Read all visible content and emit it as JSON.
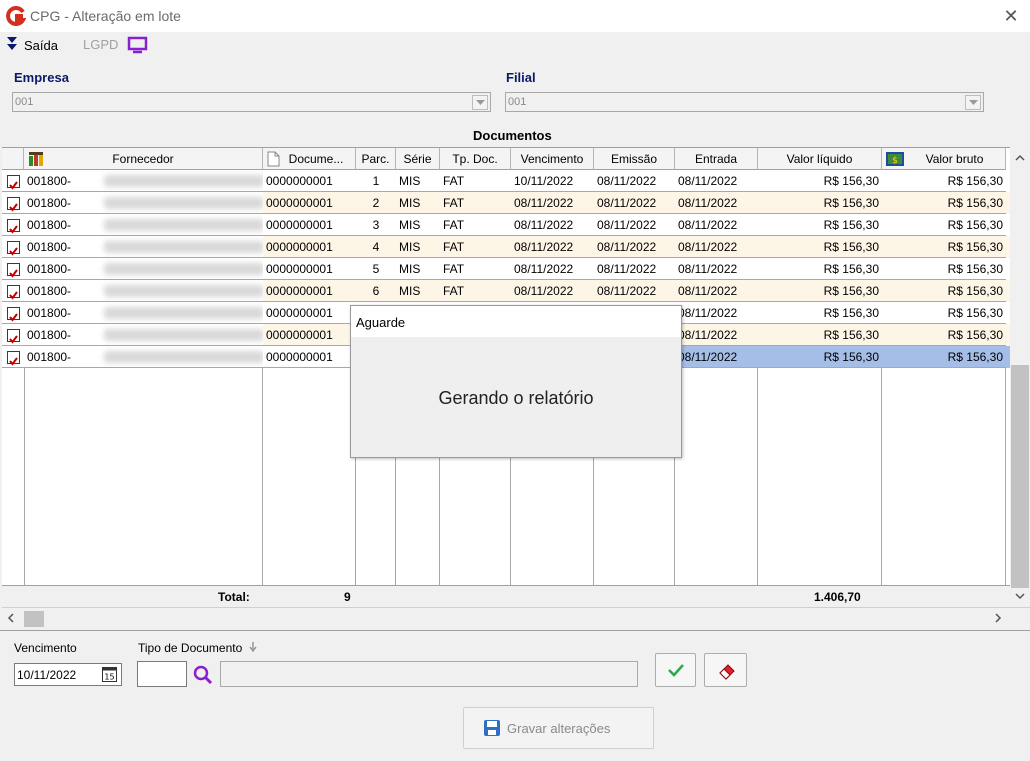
{
  "window": {
    "title": "CPG - Alteração em lote",
    "close_icon": "close-icon"
  },
  "toolbar": {
    "saida_label": "Saída",
    "lgpd_label": "LGPD"
  },
  "filters": {
    "empresa_label": "Empresa",
    "empresa_value": "001",
    "filial_label": "Filial",
    "filial_value": "001"
  },
  "grid": {
    "title": "Documentos",
    "headers": {
      "fornecedor": "Fornecedor",
      "documento": "Docume...",
      "parc": "Parc.",
      "serie": "Série",
      "tpdoc": "Tp. Doc.",
      "vencimento": "Vencimento",
      "emissao": "Emissão",
      "entrada": "Entrada",
      "valor_liquido": "Valor líquido",
      "valor_bruto": "Valor bruto"
    },
    "rows": [
      {
        "checked": true,
        "fornecedor": "001800-",
        "documento": "0000000001",
        "parc": "1",
        "serie": "MIS",
        "tpdoc": "FAT",
        "vencimento": "10/11/2022",
        "emissao": "08/11/2022",
        "entrada": "08/11/2022",
        "valor_liquido": "R$ 156,30",
        "valor_bruto": "R$ 156,30"
      },
      {
        "checked": true,
        "fornecedor": "001800-",
        "documento": "0000000001",
        "parc": "2",
        "serie": "MIS",
        "tpdoc": "FAT",
        "vencimento": "08/11/2022",
        "emissao": "08/11/2022",
        "entrada": "08/11/2022",
        "valor_liquido": "R$ 156,30",
        "valor_bruto": "R$ 156,30"
      },
      {
        "checked": true,
        "fornecedor": "001800-",
        "documento": "0000000001",
        "parc": "3",
        "serie": "MIS",
        "tpdoc": "FAT",
        "vencimento": "08/11/2022",
        "emissao": "08/11/2022",
        "entrada": "08/11/2022",
        "valor_liquido": "R$ 156,30",
        "valor_bruto": "R$ 156,30"
      },
      {
        "checked": true,
        "fornecedor": "001800-",
        "documento": "0000000001",
        "parc": "4",
        "serie": "MIS",
        "tpdoc": "FAT",
        "vencimento": "08/11/2022",
        "emissao": "08/11/2022",
        "entrada": "08/11/2022",
        "valor_liquido": "R$ 156,30",
        "valor_bruto": "R$ 156,30"
      },
      {
        "checked": true,
        "fornecedor": "001800-",
        "documento": "0000000001",
        "parc": "5",
        "serie": "MIS",
        "tpdoc": "FAT",
        "vencimento": "08/11/2022",
        "emissao": "08/11/2022",
        "entrada": "08/11/2022",
        "valor_liquido": "R$ 156,30",
        "valor_bruto": "R$ 156,30"
      },
      {
        "checked": true,
        "fornecedor": "001800-",
        "documento": "0000000001",
        "parc": "6",
        "serie": "MIS",
        "tpdoc": "FAT",
        "vencimento": "08/11/2022",
        "emissao": "08/11/2022",
        "entrada": "08/11/2022",
        "valor_liquido": "R$ 156,30",
        "valor_bruto": "R$ 156,30"
      },
      {
        "checked": true,
        "fornecedor": "001800-",
        "documento": "0000000001",
        "parc": "",
        "serie": "",
        "tpdoc": "",
        "vencimento": "",
        "emissao": "",
        "entrada": "08/11/2022",
        "valor_liquido": "R$ 156,30",
        "valor_bruto": "R$ 156,30"
      },
      {
        "checked": true,
        "fornecedor": "001800-",
        "documento": "0000000001",
        "parc": "",
        "serie": "",
        "tpdoc": "",
        "vencimento": "",
        "emissao": "",
        "entrada": "08/11/2022",
        "valor_liquido": "R$ 156,30",
        "valor_bruto": "R$ 156,30"
      },
      {
        "checked": true,
        "fornecedor": "001800-",
        "documento": "0000000001",
        "parc": "",
        "serie": "",
        "tpdoc": "",
        "vencimento": "",
        "emissao": "",
        "entrada": "08/11/2022",
        "valor_liquido": "R$ 156,30",
        "valor_bruto": "R$ 156,30"
      }
    ],
    "total_label": "Total:",
    "total_count": "9",
    "total_value": "1.406,70"
  },
  "bottom": {
    "vencimento_label": "Vencimento",
    "vencimento_value": "10/11/2022",
    "tipo_documento_label": "Tipo de Documento",
    "gravar_label": "Gravar alterações"
  },
  "modal": {
    "title": "Aguarde",
    "message": "Gerando o relatório"
  },
  "colors": {
    "row_even": "#ffffff",
    "row_odd": "#fdf6e6",
    "row_selected": "#a4bee8",
    "label_blue": "#0a1a6b",
    "check_red": "#c00000",
    "accent_purple": "#8a1fd1"
  }
}
